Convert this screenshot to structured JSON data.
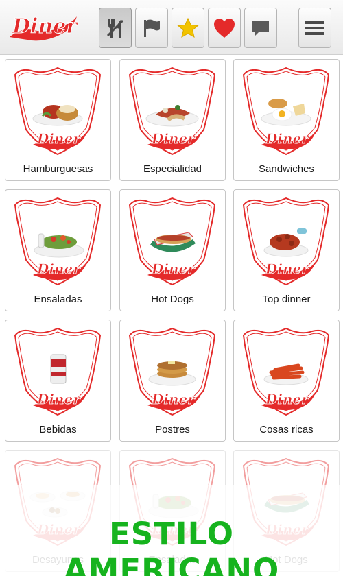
{
  "brand": {
    "logo_text": "Diner",
    "accent_color": "#e42a2a"
  },
  "toolbar": {
    "buttons": [
      {
        "icon": "cutlery-icon",
        "active": true
      },
      {
        "icon": "flag-icon",
        "active": false
      },
      {
        "icon": "star-icon",
        "active": false
      },
      {
        "icon": "heart-icon",
        "active": false
      },
      {
        "icon": "chat-bubble-icon",
        "active": false
      },
      {
        "icon": "menu-icon",
        "active": false
      }
    ]
  },
  "menu": {
    "items": [
      {
        "label": "Hamburguesas",
        "image": "burger-plate"
      },
      {
        "label": "Especialidad",
        "image": "burrito-plate"
      },
      {
        "label": "Sandwiches",
        "image": "sandwich-egg-plate"
      },
      {
        "label": "Ensaladas",
        "image": "salad-plate"
      },
      {
        "label": "Hot Dogs",
        "image": "hotdog-basket"
      },
      {
        "label": "Top dinner",
        "image": "blooming-onion-plate"
      },
      {
        "label": "Bebidas",
        "image": "soda-can"
      },
      {
        "label": "Postres",
        "image": "pancakes-plate"
      },
      {
        "label": "Cosas ricas",
        "image": "sweet-potato-fries"
      },
      {
        "label": "Desayunos",
        "image": "breakfast-plates"
      },
      {
        "label": "Ensaladas",
        "image": "salad-plate"
      },
      {
        "label": "Hot Dogs",
        "image": "hotdog-basket"
      }
    ]
  },
  "banner": {
    "text": "ESTILO AMERICANO",
    "color": "#16b31e"
  }
}
